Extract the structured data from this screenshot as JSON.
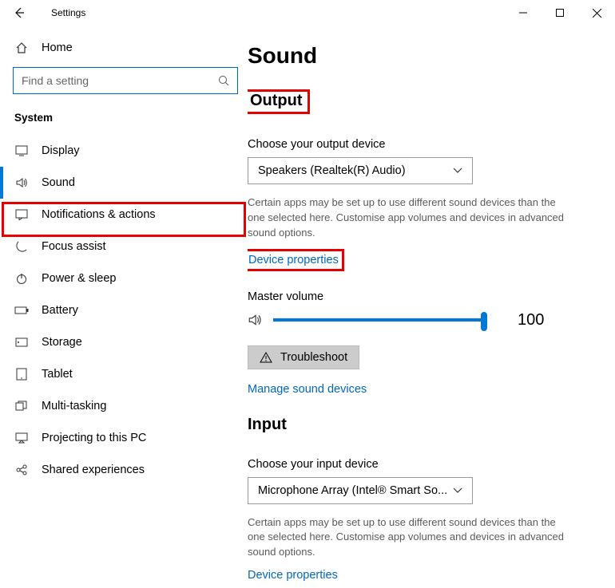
{
  "window": {
    "title": "Settings"
  },
  "sidebar": {
    "home": "Home",
    "search_placeholder": "Find a setting",
    "section": "System",
    "items": [
      {
        "label": "Display"
      },
      {
        "label": "Sound"
      },
      {
        "label": "Notifications & actions"
      },
      {
        "label": "Focus assist"
      },
      {
        "label": "Power & sleep"
      },
      {
        "label": "Battery"
      },
      {
        "label": "Storage"
      },
      {
        "label": "Tablet"
      },
      {
        "label": "Multi-tasking"
      },
      {
        "label": "Projecting to this PC"
      },
      {
        "label": "Shared experiences"
      }
    ]
  },
  "content": {
    "title": "Sound",
    "output": {
      "heading": "Output",
      "choose_label": "Choose your output device",
      "device": "Speakers (Realtek(R) Audio)",
      "help": "Certain apps may be set up to use different sound devices than the one selected here. Customise app volumes and devices in advanced sound options.",
      "device_properties": "Device properties",
      "master_volume_label": "Master volume",
      "volume": "100",
      "troubleshoot": "Troubleshoot",
      "manage": "Manage sound devices"
    },
    "input": {
      "heading": "Input",
      "choose_label": "Choose your input device",
      "device": "Microphone Array (Intel® Smart So...",
      "help": "Certain apps may be set up to use different sound devices than the one selected here. Customise app volumes and devices in advanced sound options.",
      "device_properties": "Device properties"
    }
  }
}
